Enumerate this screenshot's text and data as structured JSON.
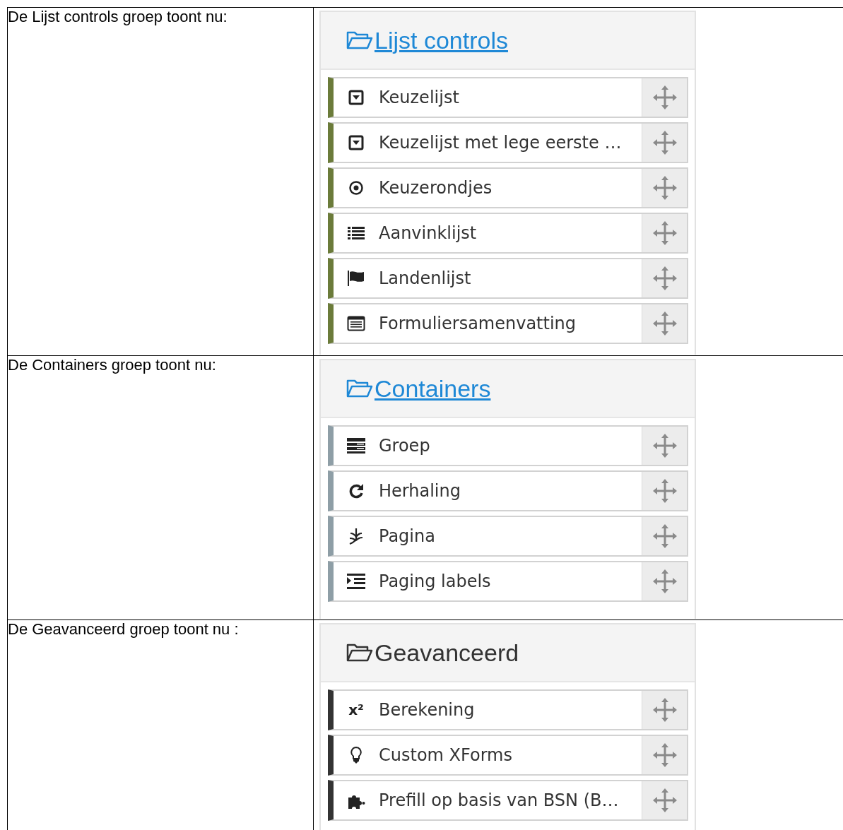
{
  "rows": [
    {
      "caption": "De Lijst controls groep toont nu:",
      "group": {
        "title": "Lijst controls",
        "link": true,
        "color": "#6b7b3a",
        "items": [
          {
            "label": "Keuzelijst",
            "kind": "select"
          },
          {
            "label": "Keuzelijst met lege eerste …",
            "kind": "select"
          },
          {
            "label": "Keuzerondjes",
            "kind": "radio"
          },
          {
            "label": "Aanvinklijst",
            "kind": "list"
          },
          {
            "label": "Landenlijst",
            "kind": "flag"
          },
          {
            "label": "Formuliersamenvatting",
            "kind": "summary"
          }
        ]
      }
    },
    {
      "caption": "De Containers groep toont nu:",
      "group": {
        "title": "Containers",
        "link": true,
        "color": "#8e9ea6",
        "items": [
          {
            "label": "Groep",
            "kind": "group"
          },
          {
            "label": "Herhaling",
            "kind": "repeat"
          },
          {
            "label": "Pagina",
            "kind": "leaf"
          },
          {
            "label": "Paging labels",
            "kind": "indent"
          }
        ]
      }
    },
    {
      "caption": "De Geavanceerd groep toont nu :",
      "group": {
        "title": "Geavanceerd",
        "link": false,
        "color": "#333333",
        "items": [
          {
            "label": "Berekening",
            "kind": "glyph",
            "glyph": "x²"
          },
          {
            "label": "Custom XForms",
            "kind": "bulb"
          },
          {
            "label": "Prefill op basis van BSN (B…",
            "kind": "puzzle"
          }
        ]
      }
    }
  ]
}
